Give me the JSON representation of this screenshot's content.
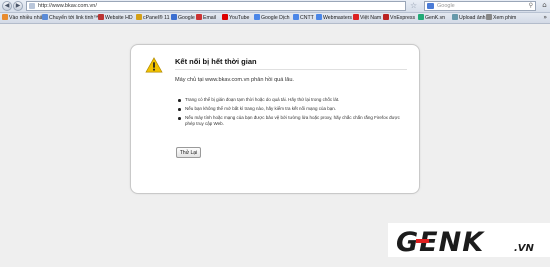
{
  "browser": {
    "url": "http://www.bkav.com.vn/",
    "search_placeholder": "Google"
  },
  "bookmarks": [
    {
      "label": "Vào nhiều nhất",
      "color": "#e88b2e"
    },
    {
      "label": "Chuyển tới link tinh™",
      "color": "#5a8bd8"
    },
    {
      "label": "Website HD",
      "color": "#b33"
    },
    {
      "label": "cPanel® 11",
      "color": "#d4a017"
    },
    {
      "label": "Google",
      "color": "#3b6fd1"
    },
    {
      "label": "Email",
      "color": "#c33"
    },
    {
      "label": "YouTube",
      "color": "#d00"
    },
    {
      "label": "Google Dịch",
      "color": "#4a86e8"
    },
    {
      "label": "CNTT",
      "color": "#4a86e8"
    },
    {
      "label": "Webmasters",
      "color": "#4a86e8"
    },
    {
      "label": "Việt Nam",
      "color": "#d22"
    },
    {
      "label": "VnExpress",
      "color": "#b22"
    },
    {
      "label": "GenK.vn",
      "color": "#2a7"
    },
    {
      "label": "Upload ảnh",
      "color": "#69a"
    },
    {
      "label": "Xem phim",
      "color": "#888"
    }
  ],
  "error": {
    "title": "Kết nối bị hết thời gian",
    "short": "Máy chủ tại www.bkav.com.vn phản hồi quá lâu.",
    "items": [
      "Trang có thể bị gián đoạn tạm thời hoặc do quá tải. Hãy thử lại trong chốc lát.",
      "Nếu bạn không thể mở bất kì trang nào, hãy kiểm tra kết nối mạng của bạn.",
      "Nếu máy tính hoặc mạng của bạn được bảo vệ bởi tường lửa hoặc proxy, hãy chắc chắn rằng Firefox được phép truy cập Web."
    ],
    "retry_label": "Thử Lại"
  },
  "watermark": {
    "brand": "GENK",
    "suffix": ".VN"
  },
  "colors": {
    "warning": "#f2c200",
    "brand_dark": "#1c1c1c",
    "brand_red": "#e02020"
  }
}
